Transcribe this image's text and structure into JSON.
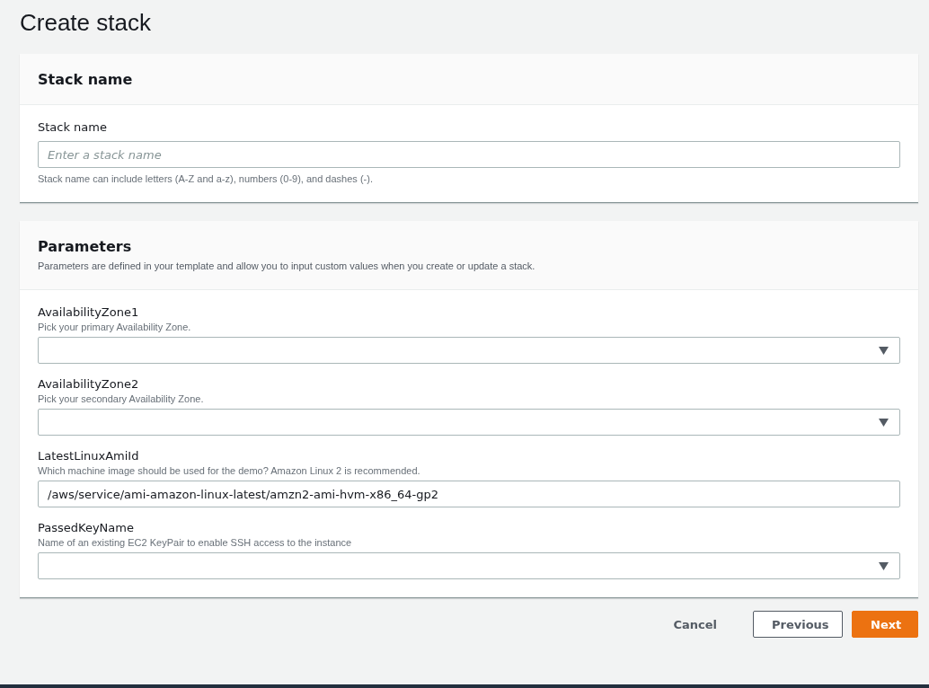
{
  "page_title": "Create stack",
  "stack_name_section": {
    "heading": "Stack name",
    "field": {
      "label": "Stack name",
      "placeholder": "Enter a stack name",
      "hint": "Stack name can include letters (A-Z and a-z), numbers (0-9), and dashes (-)."
    }
  },
  "parameters_section": {
    "heading": "Parameters",
    "description": "Parameters are defined in your template and allow you to input custom values when you create or update a stack.",
    "fields": [
      {
        "kind": "select",
        "label": "AvailabilityZone1",
        "description": "Pick your primary Availability Zone."
      },
      {
        "kind": "select",
        "label": "AvailabilityZone2",
        "description": "Pick your secondary Availability Zone."
      },
      {
        "kind": "text",
        "label": "LatestLinuxAmiId",
        "description": "Which machine image should be used for the demo? Amazon Linux 2 is recommended.",
        "value": "/aws/service/ami-amazon-linux-latest/amzn2-ami-hvm-x86_64-gp2"
      },
      {
        "kind": "select",
        "label": "PassedKeyName",
        "description": "Name of an existing EC2 KeyPair to enable SSH access to the instance"
      }
    ]
  },
  "buttons": [
    {
      "kind": "link",
      "label": "Cancel"
    },
    {
      "kind": "normal",
      "label": "Previous"
    },
    {
      "kind": "primary",
      "label": "Next"
    }
  ]
}
